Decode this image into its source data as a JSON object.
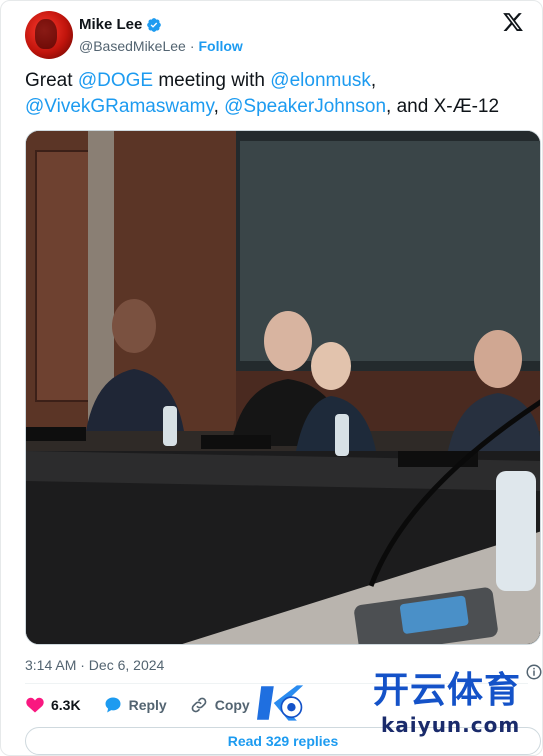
{
  "author": {
    "name": "Mike Lee",
    "handle": "@BasedMikeLee",
    "separator": "·",
    "follow_label": "Follow"
  },
  "tweet": {
    "parts": [
      {
        "text": "Great ",
        "type": "text"
      },
      {
        "text": "@DOGE",
        "type": "mention"
      },
      {
        "text": " meeting with ",
        "type": "text"
      },
      {
        "text": "@elonmusk",
        "type": "mention"
      },
      {
        "text": ", ",
        "type": "text"
      },
      {
        "text": "@VivekGRamaswamy",
        "type": "mention"
      },
      {
        "text": ", ",
        "type": "text"
      },
      {
        "text": "@SpeakerJohnson",
        "type": "mention"
      },
      {
        "text": ", and X-Æ-12",
        "type": "text"
      }
    ]
  },
  "meta": {
    "timestamp": "3:14 AM · Dec 6, 2024"
  },
  "actions": {
    "likes": "6.3K",
    "reply_label": "Reply",
    "copy_label": "Copy"
  },
  "replies_button": "Read 329 replies",
  "watermark": {
    "cn": "开云体育",
    "en": "kaiyun.com"
  },
  "colors": {
    "accent": "#1d9bf0",
    "like": "#f91880",
    "text": "#0f1419",
    "muted": "#536471"
  }
}
